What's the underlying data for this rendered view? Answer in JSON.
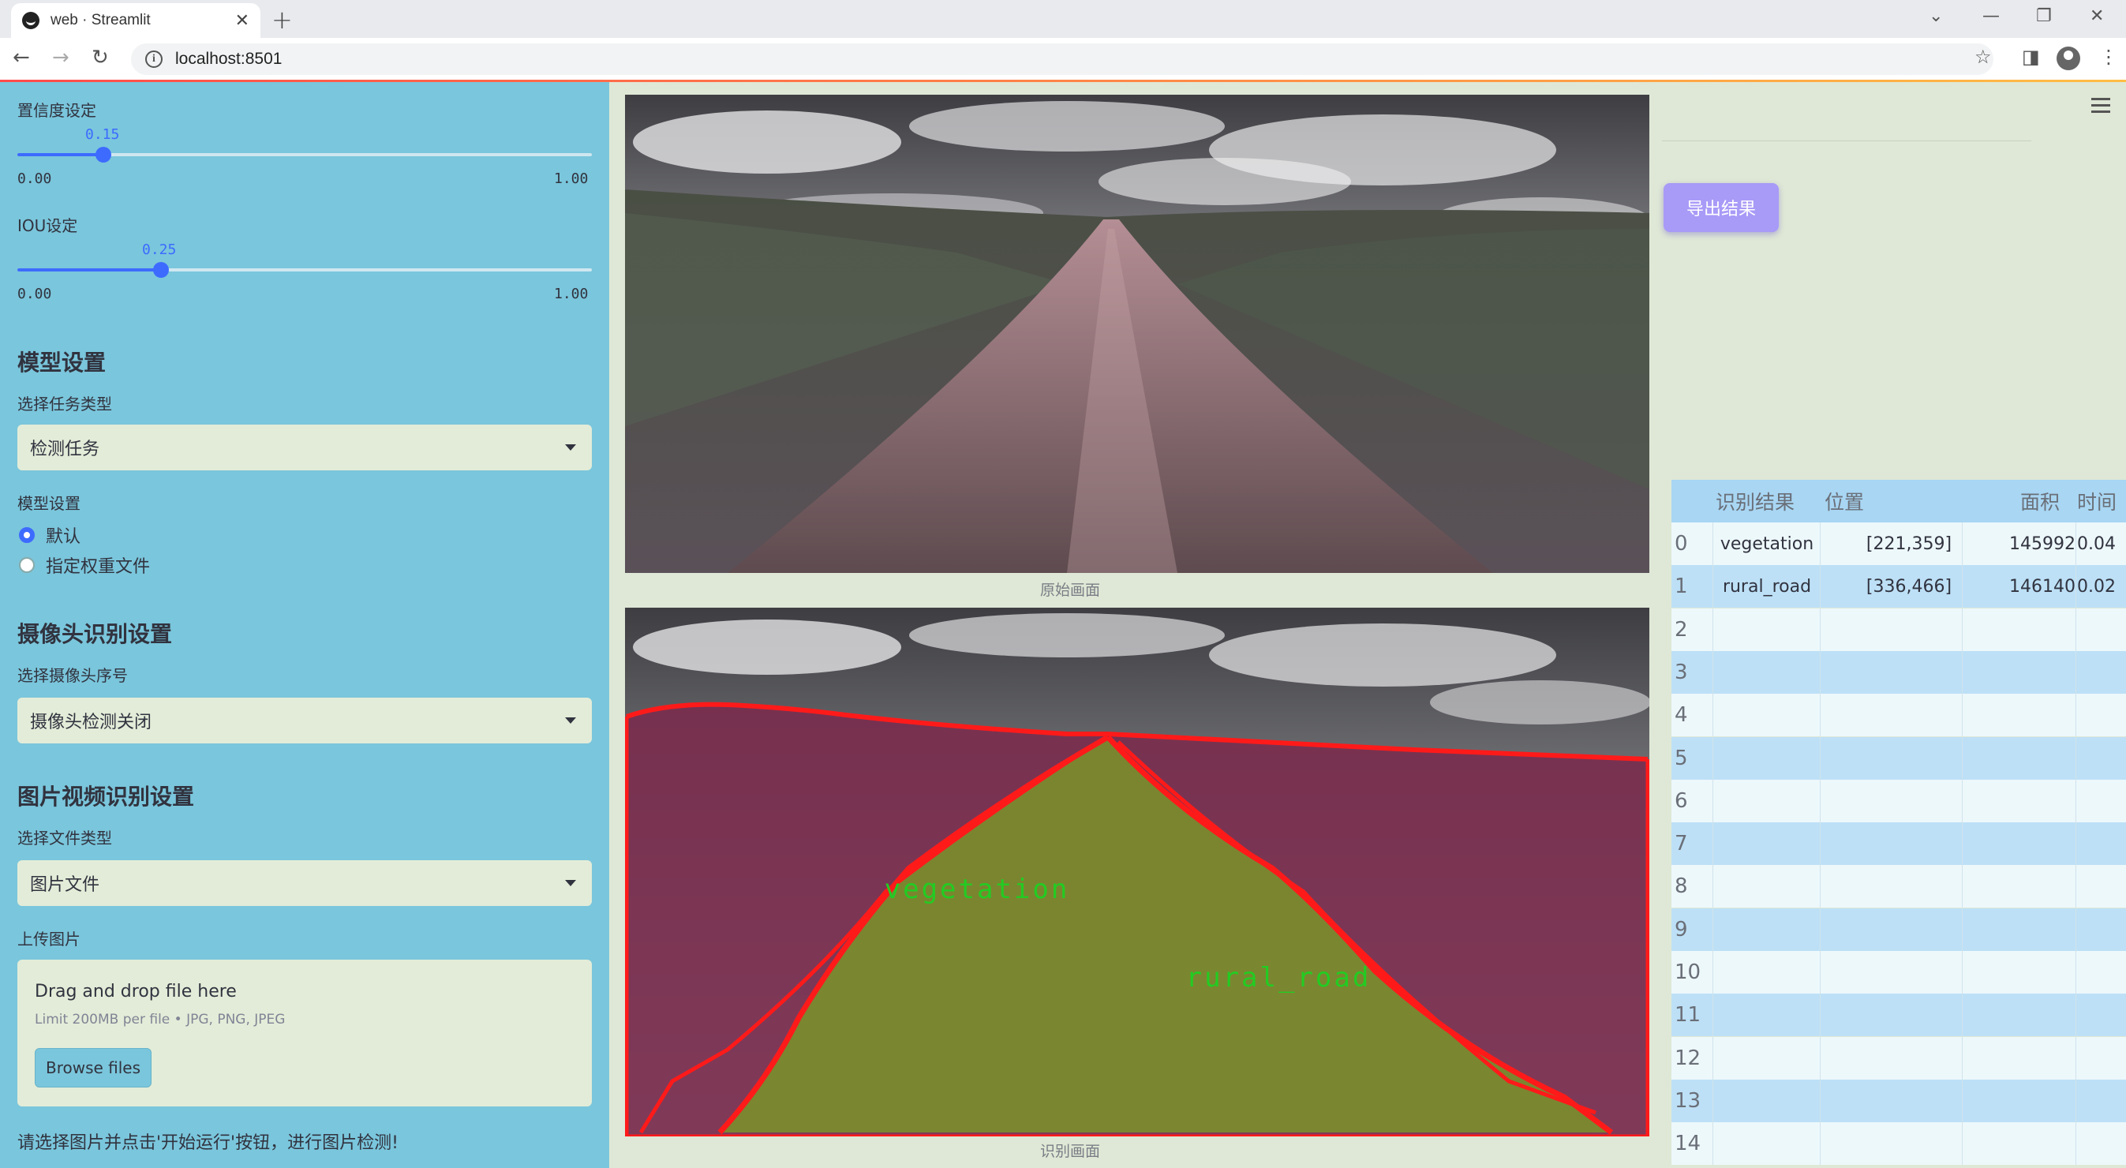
{
  "browser": {
    "tab_title": "web · Streamlit",
    "url": "localhost:8501"
  },
  "sidebar": {
    "confidence": {
      "label": "置信度设定",
      "value": "0.15",
      "min": "0.00",
      "max": "1.00",
      "fraction": 0.15
    },
    "iou": {
      "label": "IOU设定",
      "value": "0.25",
      "min": "0.00",
      "max": "1.00",
      "fraction": 0.25
    },
    "model_heading": "模型设置",
    "task_type_label": "选择任务类型",
    "task_type_value": "检测任务",
    "model_setting_label": "模型设置",
    "model_options": [
      "默认",
      "指定权重文件"
    ],
    "model_selected": 0,
    "camera_heading": "摄像头识别设置",
    "camera_label": "选择摄像头序号",
    "camera_value": "摄像头检测关闭",
    "media_heading": "图片视频识别设置",
    "file_type_label": "选择文件类型",
    "file_type_value": "图片文件",
    "upload_label": "上传图片",
    "drag_text": "Drag and drop file here",
    "limit_text": "Limit 200MB per file • JPG, PNG, JPEG",
    "browse_label": "Browse files",
    "footer_text": "请选择图片并点击'开始运行'按钮，进行图片检测!"
  },
  "main": {
    "original_caption": "原始画面",
    "result_caption": "识别画面",
    "detections": [
      "vegetation",
      "rural_road"
    ],
    "detection_color": "#22cc22",
    "contour_color": "#ff1a1a"
  },
  "right": {
    "export_label": "导出结果",
    "table": {
      "headers": [
        "识别结果",
        "位置",
        "面积",
        "时间"
      ],
      "rows": [
        {
          "index": "0",
          "result": "vegetation",
          "position": "[221,359]",
          "area": "145992",
          "time": "0.04"
        },
        {
          "index": "1",
          "result": "rural_road",
          "position": "[336,466]",
          "area": "146140",
          "time": "0.02"
        },
        {
          "index": "2"
        },
        {
          "index": "3"
        },
        {
          "index": "4"
        },
        {
          "index": "5"
        },
        {
          "index": "6"
        },
        {
          "index": "7"
        },
        {
          "index": "8"
        },
        {
          "index": "9"
        },
        {
          "index": "10"
        },
        {
          "index": "11"
        },
        {
          "index": "12"
        },
        {
          "index": "13"
        },
        {
          "index": "14"
        }
      ]
    }
  },
  "icons": [
    "streamlit-logo-icon",
    "close-icon",
    "plus-icon",
    "back-icon",
    "forward-icon",
    "reload-icon",
    "info-icon",
    "star-icon",
    "sidepanel-icon",
    "profile-icon",
    "kebab-menu-icon",
    "hamburger-menu-icon",
    "chevron-down-icon"
  ]
}
